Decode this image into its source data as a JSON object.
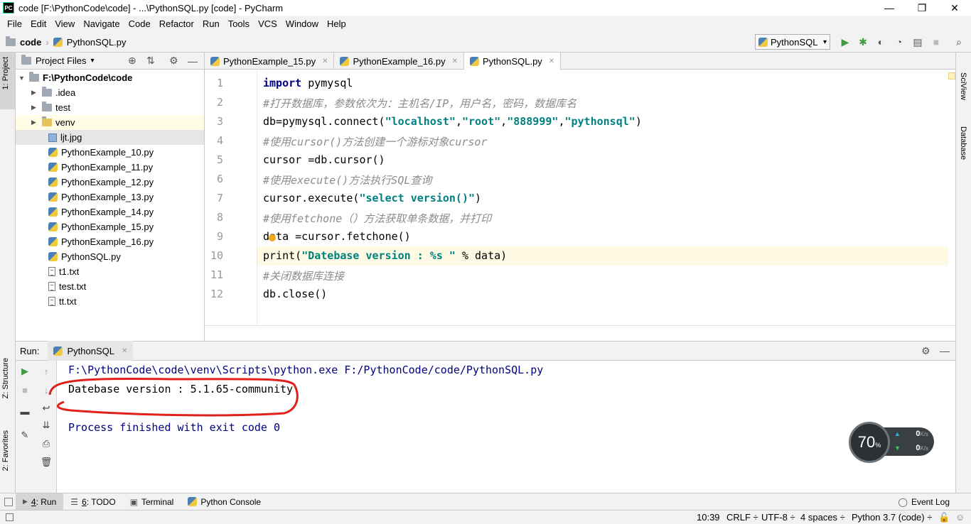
{
  "window": {
    "title": "code [F:\\PythonCode\\code] - ...\\PythonSQL.py [code] - PyCharm",
    "app_icon_text": "PC",
    "minimize": "—",
    "maximize": "❐",
    "close": "✕"
  },
  "menu": [
    "File",
    "Edit",
    "View",
    "Navigate",
    "Code",
    "Refactor",
    "Run",
    "Tools",
    "VCS",
    "Window",
    "Help"
  ],
  "breadcrumb": {
    "folder": "code",
    "file": "PythonSQL.py"
  },
  "run_config": {
    "name": "PythonSQL"
  },
  "side_tabs": {
    "project": "1: Project",
    "structure": "Z: Structure",
    "favorites": "2: Favorites",
    "sciview": "SciView",
    "database": "Database"
  },
  "project_panel": {
    "title": "Project Files",
    "root": "F:\\PythonCode\\code",
    "items": [
      {
        "label": ".idea",
        "type": "folder"
      },
      {
        "label": "test",
        "type": "folder"
      },
      {
        "label": "venv",
        "type": "folder"
      },
      {
        "label": "ljt.jpg",
        "type": "image"
      },
      {
        "label": "PythonExample_10.py",
        "type": "py"
      },
      {
        "label": "PythonExample_11.py",
        "type": "py"
      },
      {
        "label": "PythonExample_12.py",
        "type": "py"
      },
      {
        "label": "PythonExample_13.py",
        "type": "py"
      },
      {
        "label": "PythonExample_14.py",
        "type": "py"
      },
      {
        "label": "PythonExample_15.py",
        "type": "py"
      },
      {
        "label": "PythonExample_16.py",
        "type": "py"
      },
      {
        "label": "PythonSQL.py",
        "type": "py"
      },
      {
        "label": "t1.txt",
        "type": "txt"
      },
      {
        "label": "test.txt",
        "type": "txt"
      },
      {
        "label": "tt.txt",
        "type": "txt"
      }
    ]
  },
  "editor_tabs": [
    "PythonExample_15.py",
    "PythonExample_16.py",
    "PythonSQL.py"
  ],
  "code_lines": {
    "n": [
      "1",
      "2",
      "3",
      "4",
      "5",
      "6",
      "7",
      "8",
      "9",
      "10",
      "11",
      "12"
    ],
    "l1_kw": "import",
    "l1_rest": " pymysql",
    "l2": "#打开数据库，参数依次为：主机名/IP，用户名，密码，数据库名",
    "l3_a": "db=pymysql.connect(",
    "l3_s1": "\"localhost\"",
    "l3_c1": ",",
    "l3_s2": "\"root\"",
    "l3_c2": ",",
    "l3_s3": "\"888999\"",
    "l3_c3": ",",
    "l3_s4": "\"pythonsql\"",
    "l3_end": ")",
    "l4": "#使用cursor()方法创建一个游标对象cursor",
    "l5": "cursor =db.cursor()",
    "l6": "#使用execute()方法执行SQL查询",
    "l7_a": "cursor.execute(",
    "l7_s": "\"select version()\"",
    "l7_end": ")",
    "l8": "#使用fetchone（）方法获取单条数据，并打印",
    "l9": "data =cursor.fetchone()",
    "l10_a": "print(",
    "l10_s": "\"Datebase version : %s \"",
    "l10_rest": " % data)",
    "l11": "#关闭数据库连接",
    "l12": "db.close()"
  },
  "run_panel": {
    "label": "Run:",
    "tab": "PythonSQL",
    "output": [
      "F:\\PythonCode\\code\\venv\\Scripts\\python.exe F:/PythonCode/code/PythonSQL.py",
      "Datebase version : 5.1.65-community",
      "",
      "Process finished with exit code 0"
    ]
  },
  "speed_widget": {
    "percent": "70",
    "unit": "%",
    "up": "0",
    "down": "0",
    "speed_unit": "K/s"
  },
  "bottom_tabs": [
    {
      "num": "4",
      "label": ": Run"
    },
    {
      "num": "6",
      "label": ": TODO"
    },
    {
      "num": "",
      "label": "Terminal"
    },
    {
      "num": "",
      "label": "Python Console"
    }
  ],
  "event_log": "Event Log",
  "status": {
    "position": "10:39",
    "line_sep": "CRLF ÷",
    "encoding": "UTF-8 ÷",
    "indent": "4 spaces ÷",
    "interpreter": "Python 3.7 (code) ÷"
  },
  "colors": {
    "keyword": "#000080",
    "string": "#008080",
    "comment": "#8c8c8c",
    "annotation": "#e0201a",
    "run_green": "#3e9b3e"
  }
}
